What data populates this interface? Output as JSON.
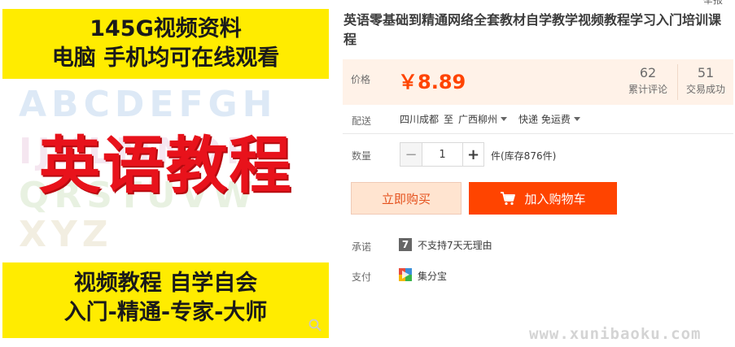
{
  "product_image": {
    "banner_top_line1": "145G视频资料",
    "banner_top_line2": "电脑 手机均可在线观看",
    "letters_row1": "ABCDEFGH",
    "letters_row2": "IJKLMNOP",
    "letters_row3": "QRSTUVW",
    "letters_row4": "XYZ",
    "main_text": "英语教程",
    "banner_bottom_line1": "视频教程 自学自会",
    "banner_bottom_line2": "入门-精通-专家-大师",
    "zoom_icon": "search-icon"
  },
  "header": {
    "report_link": "举报",
    "title": "英语零基础到精通网络全套教材自学教学视频教程学习入门培训课程"
  },
  "price": {
    "label": "价格",
    "value": "￥8.89",
    "color": "#ff4400"
  },
  "stats": [
    {
      "number": "62",
      "label": "累计评论"
    },
    {
      "number": "51",
      "label": "交易成功"
    }
  ],
  "delivery": {
    "label": "配送",
    "from": "四川成都",
    "to_word": "至",
    "to": "广西柳州",
    "method": "快递 免运费"
  },
  "quantity": {
    "label": "数量",
    "value": "1",
    "minus": "−",
    "plus": "+",
    "stock": "件(库存876件)"
  },
  "actions": {
    "buy_now": "立即购买",
    "add_to_cart": "加入购物车",
    "accent": "#ff4400"
  },
  "promise": {
    "label": "承诺",
    "icon_glyph": "7",
    "text": "不支持7天无理由"
  },
  "payment": {
    "label": "支付",
    "text": "集分宝"
  },
  "watermark": "www.xunibaoku.com"
}
